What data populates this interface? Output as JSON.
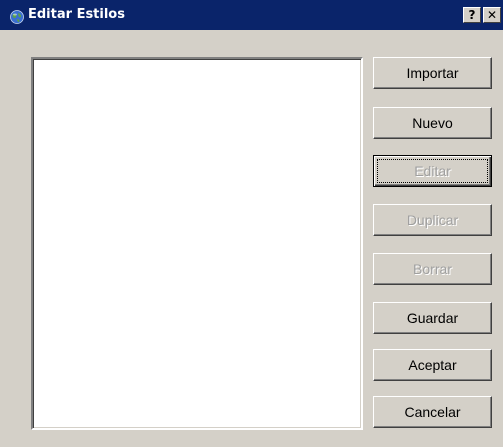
{
  "window": {
    "title": "Editar Estilos",
    "help_label": "?",
    "close_label": "✕"
  },
  "style_list": {
    "items": []
  },
  "buttons": {
    "import": {
      "label": "Importar",
      "enabled": true
    },
    "new": {
      "label": "Nuevo",
      "enabled": true
    },
    "edit": {
      "label": "Editar",
      "enabled": false,
      "focused": true
    },
    "duplicate": {
      "label": "Duplicar",
      "enabled": false
    },
    "delete": {
      "label": "Borrar",
      "enabled": false
    },
    "save": {
      "label": "Guardar",
      "enabled": true
    },
    "accept": {
      "label": "Aceptar",
      "enabled": true
    },
    "cancel": {
      "label": "Cancelar",
      "enabled": true
    }
  },
  "colors": {
    "titlebar": "#0a246a",
    "dialog_face": "#d4d0c8",
    "disabled_text": "#a0a0a0"
  },
  "icons": {
    "title_icon": "globe-icon"
  }
}
